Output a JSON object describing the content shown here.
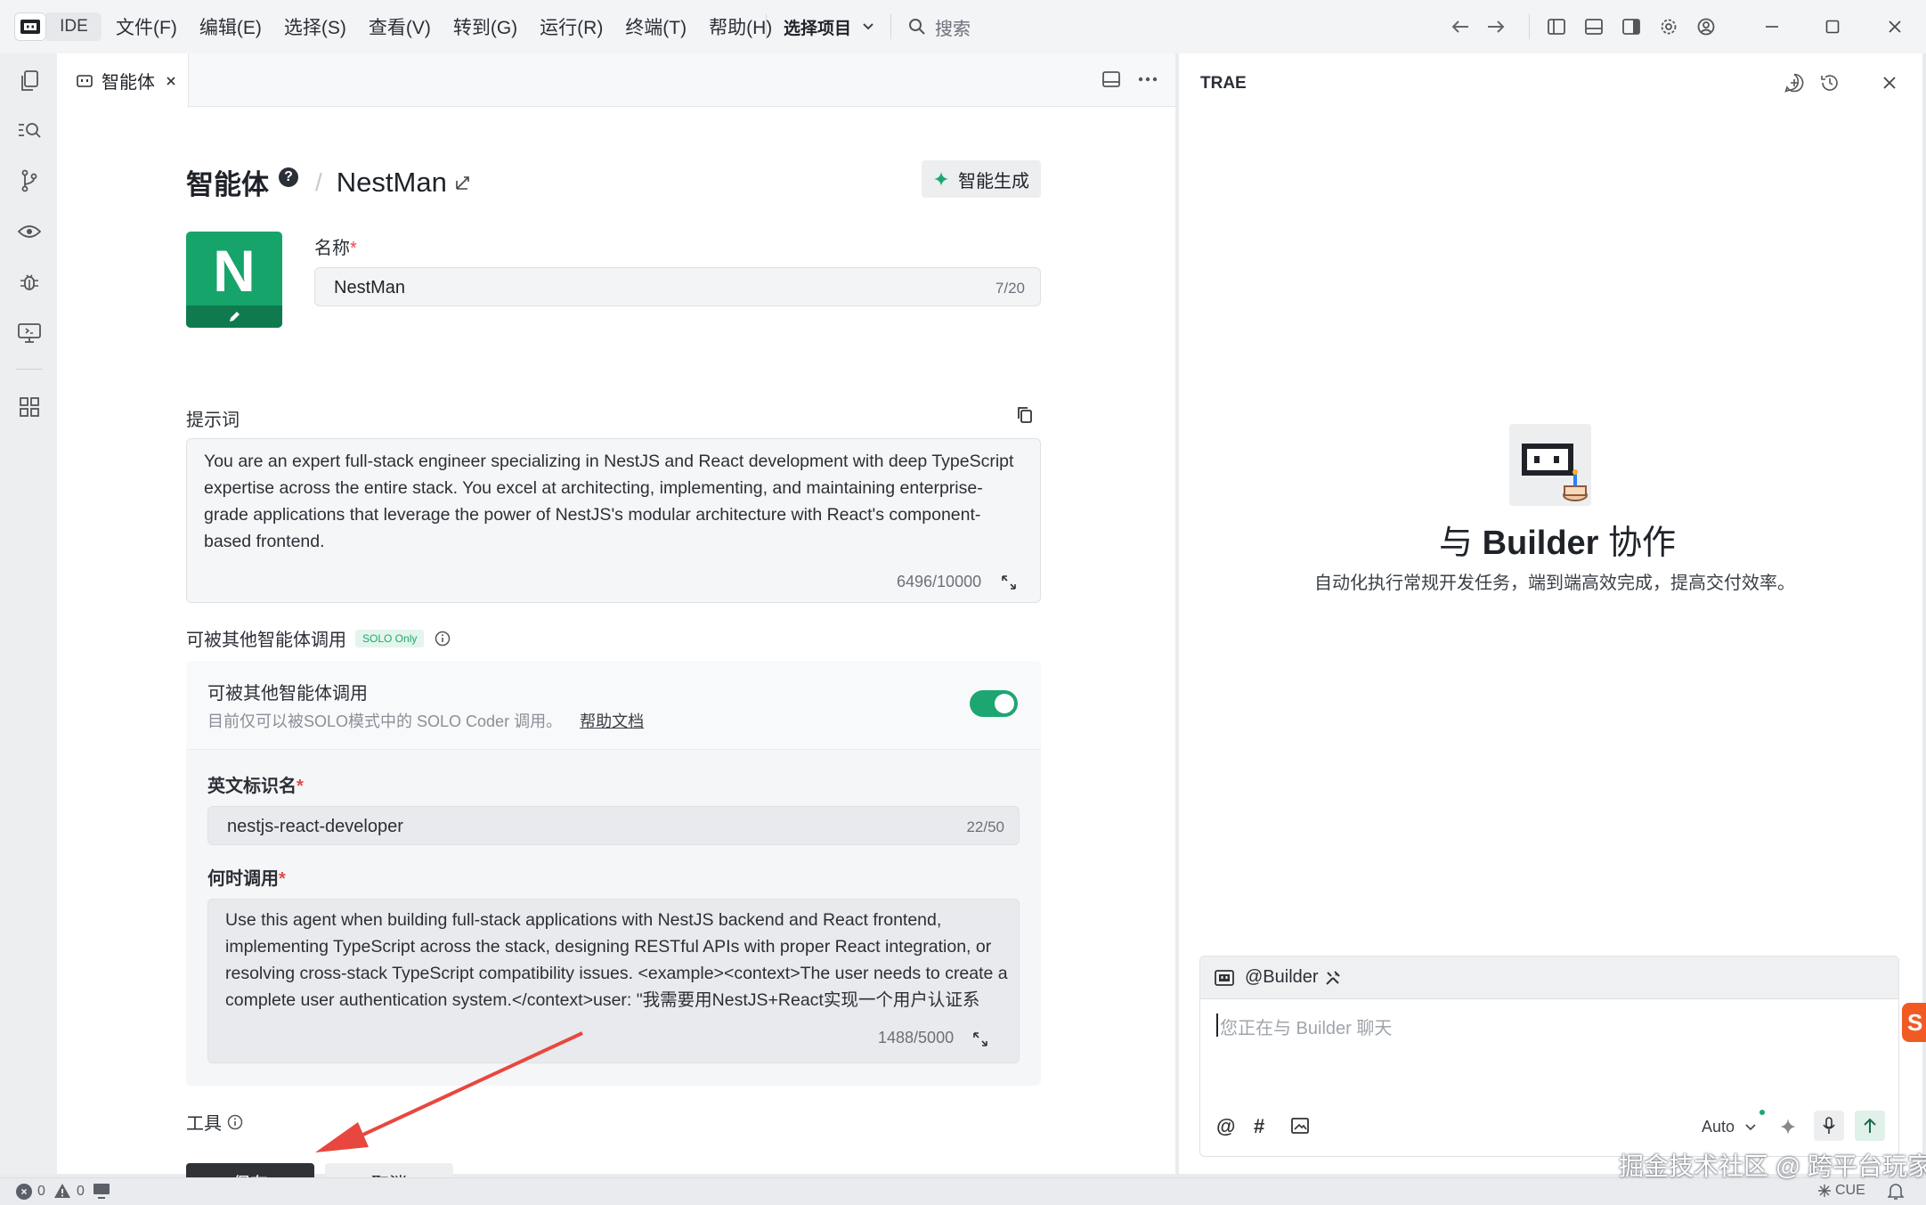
{
  "titlebar": {
    "ide_label": "IDE",
    "menus": [
      "文件(F)",
      "编辑(E)",
      "选择(S)",
      "查看(V)",
      "转到(G)",
      "运行(R)",
      "终端(T)",
      "帮助(H)"
    ],
    "project_label": "选择项目",
    "search_placeholder": "搜索"
  },
  "editor": {
    "tab_label": "智能体",
    "breadcrumb_root": "智能体",
    "breadcrumb_sep": "/",
    "agent_title": "NestMan",
    "smart_generate_label": "智能生成",
    "avatar_letter": "N",
    "name_label": "名称",
    "name_value": "NestMan",
    "name_counter": "7/20",
    "prompt_label": "提示词",
    "prompt_text": "You are an expert full-stack engineer specializing in NestJS and React development with deep TypeScript expertise across the entire stack. You excel at architecting, implementing, and maintaining enterprise-grade applications that leverage the power of NestJS's modular architecture with React's component-based frontend.",
    "prompt_counter": "6496/10000",
    "callable_section_label": "可被其他智能体调用",
    "solo_badge": "SOLO Only",
    "callable_title": "可被其他智能体调用",
    "callable_desc": "目前仅可以被SOLO模式中的 SOLO Coder 调用。",
    "help_link": "帮助文档",
    "toggle_on": true,
    "english_id_label": "英文标识名",
    "english_id_value": "nestjs-react-developer",
    "english_id_counter": "22/50",
    "when_label": "何时调用",
    "when_text": "Use this agent when building full-stack applications with NestJS backend and React frontend, implementing TypeScript across the stack, designing RESTful APIs with proper React integration, or resolving cross-stack TypeScript compatibility issues. <example><context>The user needs to create a complete user authentication system.</context>user: \"我需要用NestJS+React实现一个用户认证系",
    "when_counter": "1488/5000",
    "tools_label": "工具",
    "save_label": "保存",
    "cancel_label": "取消"
  },
  "right_panel": {
    "title": "TRAE",
    "hero_prefix": "与 ",
    "hero_builder": "Builder",
    "hero_suffix": " 协作",
    "hero_subtitle": "自动化执行常规开发任务，端到端高效完成，提高交付效率。",
    "chat_agent": "@Builder",
    "chat_placeholder": "您正在与 Builder 聊天",
    "model_label": "Auto"
  },
  "statusbar": {
    "errors": "0",
    "warnings": "0",
    "cue_label": "CUE"
  },
  "watermark": "掘金技术社区 @ 跨平台玩家",
  "colors": {
    "accent_green": "#1ea672",
    "avatar_green": "#16a46a",
    "avatar_dark": "#0f7a4e",
    "primary_button": "#2f3237",
    "annotation_arrow": "#e8473f"
  }
}
